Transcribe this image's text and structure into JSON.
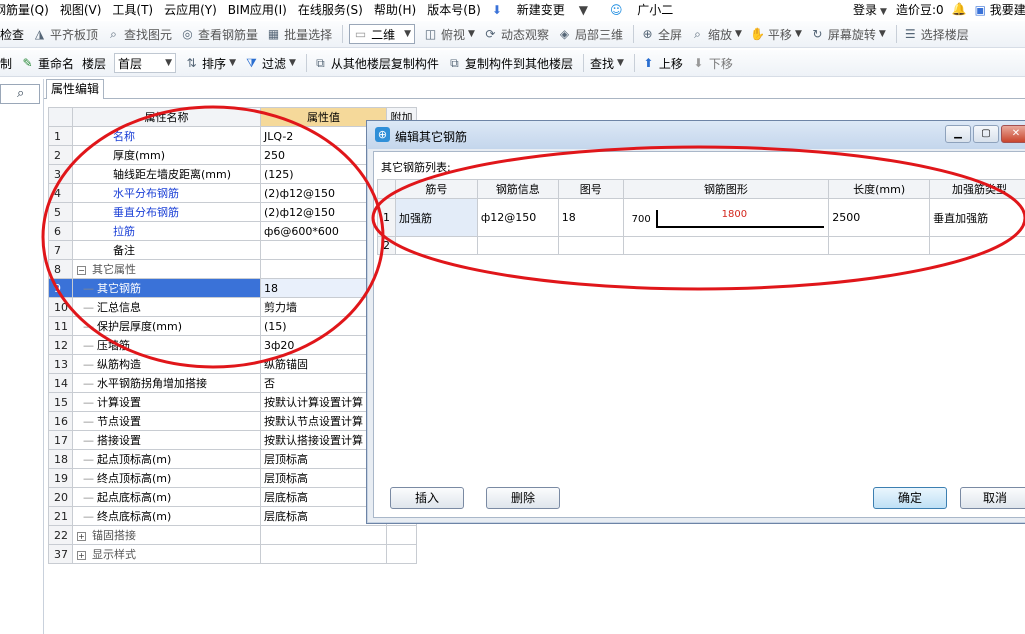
{
  "menubar": {
    "items": [
      "钢筋量(Q)",
      "视图(V)",
      "工具(T)",
      "云应用(Y)",
      "BIM应用(I)",
      "在线服务(S)",
      "帮助(H)",
      "版本号(B)"
    ],
    "new_change": "新建变更",
    "assistant": "广小二",
    "login": "登录",
    "beans": "造价豆:0",
    "want_build": "我要建"
  },
  "toolbar1": {
    "check": "检查",
    "flat_slab": "平齐板顶",
    "find_element": "查找图元",
    "view_rebar": "查看钢筋量",
    "batch_select": "批量选择",
    "view_mode": "二维",
    "top_view": "俯视",
    "dynamic_observe": "动态观察",
    "local_3d": "局部三维",
    "full_screen": "全屏",
    "zoom": "缩放",
    "pan": "平移",
    "screen_rotate": "屏幕旋转",
    "select_floor": "选择楼层"
  },
  "toolbar2": {
    "copy": "制",
    "rename": "重命名",
    "floor_label": "楼层",
    "floor_value": "首层",
    "sort": "排序",
    "filter": "过滤",
    "copy_from_floor": "从其他楼层复制构件",
    "copy_to_floor": "复制构件到其他楼层",
    "find": "查找",
    "move_up": "上移",
    "move_down": "下移"
  },
  "props": {
    "tab": "属性编辑",
    "col_name": "属性名称",
    "col_value": "属性值",
    "col_extra": "附加",
    "rows": [
      {
        "n": "1",
        "name": "名称",
        "val": "JLQ-2",
        "style": "blue",
        "indent": 0
      },
      {
        "n": "2",
        "name": "厚度(mm)",
        "val": "250",
        "style": "",
        "indent": 0
      },
      {
        "n": "3",
        "name": "轴线距左墙皮距离(mm)",
        "val": "(125)",
        "style": "",
        "indent": 0
      },
      {
        "n": "4",
        "name": "水平分布钢筋",
        "val": "(2)ф12@150",
        "style": "blue",
        "indent": 0
      },
      {
        "n": "5",
        "name": "垂直分布钢筋",
        "val": "(2)ф12@150",
        "style": "blue",
        "indent": 0
      },
      {
        "n": "6",
        "name": "拉筋",
        "val": "ф6@600*600",
        "style": "blue",
        "indent": 0
      },
      {
        "n": "7",
        "name": "备注",
        "val": "",
        "style": "",
        "indent": 0
      },
      {
        "n": "8",
        "name": "其它属性",
        "val": "",
        "style": "gray",
        "indent": 0,
        "group": "−"
      },
      {
        "n": "9",
        "name": "其它钢筋",
        "val": "18",
        "style": "",
        "indent": 1,
        "selected": true
      },
      {
        "n": "10",
        "name": "汇总信息",
        "val": "剪力墙",
        "style": "",
        "indent": 1
      },
      {
        "n": "11",
        "name": "保护层厚度(mm)",
        "val": "(15)",
        "style": "",
        "indent": 1
      },
      {
        "n": "12",
        "name": "压墙筋",
        "val": "3ф20",
        "style": "",
        "indent": 1
      },
      {
        "n": "13",
        "name": "纵筋构造",
        "val": "纵筋锚固",
        "style": "",
        "indent": 1
      },
      {
        "n": "14",
        "name": "水平钢筋拐角增加搭接",
        "val": "否",
        "style": "",
        "indent": 1
      },
      {
        "n": "15",
        "name": "计算设置",
        "val": "按默认计算设置计算",
        "style": "",
        "indent": 1
      },
      {
        "n": "16",
        "name": "节点设置",
        "val": "按默认节点设置计算",
        "style": "",
        "indent": 1
      },
      {
        "n": "17",
        "name": "搭接设置",
        "val": "按默认搭接设置计算",
        "style": "",
        "indent": 1
      },
      {
        "n": "18",
        "name": "起点顶标高(m)",
        "val": "层顶标高",
        "style": "",
        "indent": 1
      },
      {
        "n": "19",
        "name": "终点顶标高(m)",
        "val": "层顶标高",
        "style": "",
        "indent": 1
      },
      {
        "n": "20",
        "name": "起点底标高(m)",
        "val": "层底标高",
        "style": "",
        "indent": 1
      },
      {
        "n": "21",
        "name": "终点底标高(m)",
        "val": "层底标高",
        "style": "",
        "indent": 1
      },
      {
        "n": "22",
        "name": "锚固搭接",
        "val": "",
        "style": "gray",
        "indent": 0,
        "group": "+"
      },
      {
        "n": "37",
        "name": "显示样式",
        "val": "",
        "style": "gray",
        "indent": 0,
        "group": "+"
      }
    ]
  },
  "dialog": {
    "title": "编辑其它钢筋",
    "list_label": "其它钢筋列表:",
    "headers": [
      "筋号",
      "钢筋信息",
      "图号",
      "钢筋图形",
      "长度(mm)",
      "加强筋类型"
    ],
    "rows": [
      {
        "n": "1",
        "bar_no": "加强筋",
        "info": "ф12@150",
        "fig_no": "18",
        "shape_left": "700",
        "shape_len": "1800",
        "length": "2500",
        "type": "垂直加强筋"
      },
      {
        "n": "2",
        "bar_no": "",
        "info": "",
        "fig_no": "",
        "shape_left": "",
        "shape_len": "",
        "length": "",
        "type": ""
      }
    ],
    "insert": "插入",
    "delete": "删除",
    "ok": "确定",
    "cancel": "取消"
  },
  "annotation_color": "#e0161a"
}
